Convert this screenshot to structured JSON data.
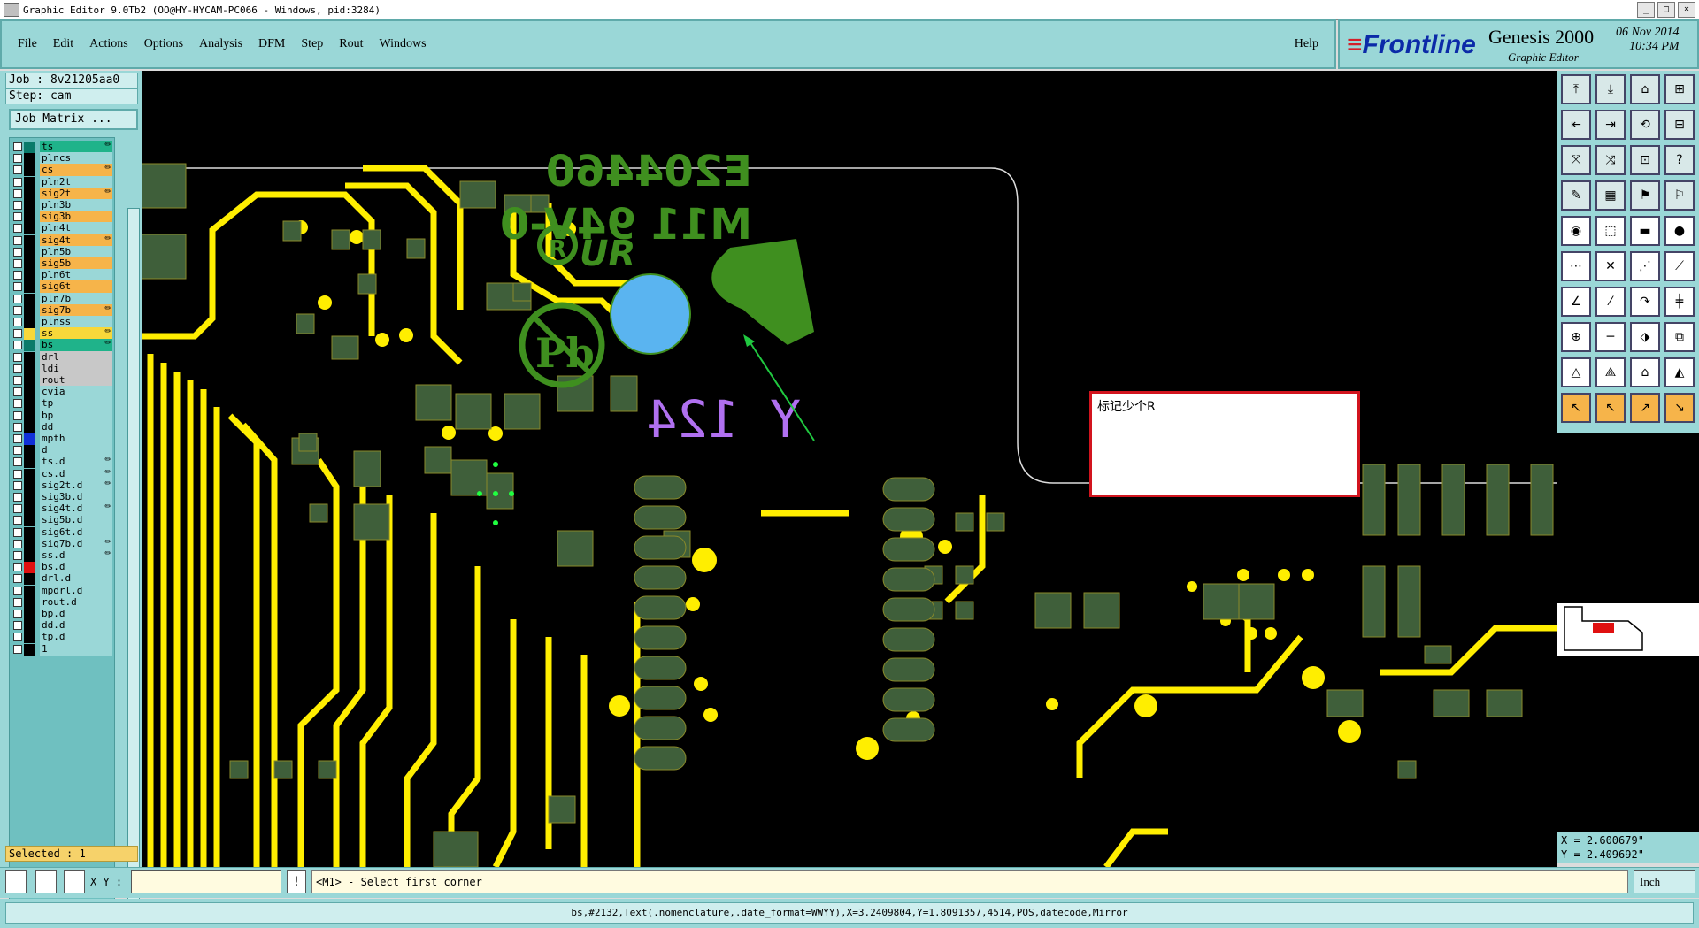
{
  "window": {
    "title": "Graphic Editor 9.0Tb2 (OO@HY-HYCAM-PC066 - Windows, pid:3284)"
  },
  "menu": {
    "items": [
      "File",
      "Edit",
      "Actions",
      "Options",
      "Analysis",
      "DFM",
      "Step",
      "Rout",
      "Windows"
    ],
    "help": "Help"
  },
  "brand": {
    "logo_main": "Frontline",
    "product": "Genesis 2000",
    "subtitle": "Graphic Editor",
    "date": "06 Nov 2014",
    "time": "10:34 PM"
  },
  "job": {
    "job_line": "Job : 8v21205aa0",
    "step_line": "Step: cam",
    "matrix_button": "Job Matrix ..."
  },
  "layers": [
    {
      "name": "ts",
      "color": "#1fb38a",
      "sw": "#0a7a6a",
      "mark": "✏"
    },
    {
      "name": "plncs",
      "color": "#9ad7d7",
      "sw": "#000000",
      "mark": ""
    },
    {
      "name": "cs",
      "color": "#f6b44a",
      "sw": "#000000",
      "mark": "✏"
    },
    {
      "name": "pln2t",
      "color": "#9ad7d7",
      "sw": "#000000",
      "mark": ""
    },
    {
      "name": "sig2t",
      "color": "#f6b44a",
      "sw": "#000000",
      "mark": "✏"
    },
    {
      "name": "pln3b",
      "color": "#9ad7d7",
      "sw": "#000000",
      "mark": ""
    },
    {
      "name": "sig3b",
      "color": "#f6b44a",
      "sw": "#000000",
      "mark": ""
    },
    {
      "name": "pln4t",
      "color": "#9ad7d7",
      "sw": "#000000",
      "mark": ""
    },
    {
      "name": "sig4t",
      "color": "#f6b44a",
      "sw": "#000000",
      "mark": "✏"
    },
    {
      "name": "pln5b",
      "color": "#9ad7d7",
      "sw": "#000000",
      "mark": ""
    },
    {
      "name": "sig5b",
      "color": "#f6b44a",
      "sw": "#000000",
      "mark": ""
    },
    {
      "name": "pln6t",
      "color": "#9ad7d7",
      "sw": "#000000",
      "mark": ""
    },
    {
      "name": "sig6t",
      "color": "#f6b44a",
      "sw": "#000000",
      "mark": ""
    },
    {
      "name": "pln7b",
      "color": "#9ad7d7",
      "sw": "#000000",
      "mark": ""
    },
    {
      "name": "sig7b",
      "color": "#f6b44a",
      "sw": "#000000",
      "mark": "✏"
    },
    {
      "name": "plnss",
      "color": "#9ad7d7",
      "sw": "#000000",
      "mark": ""
    },
    {
      "name": "ss",
      "color": "#f7d83a",
      "sw": "#f7d83a",
      "mark": "✏"
    },
    {
      "name": "bs",
      "color": "#1fb38a",
      "sw": "#0a7a6a",
      "mark": "✏"
    },
    {
      "name": "drl",
      "color": "#c8c8c8",
      "sw": "#000000",
      "mark": ""
    },
    {
      "name": "ldi",
      "color": "#c8c8c8",
      "sw": "#000000",
      "mark": ""
    },
    {
      "name": "rout",
      "color": "#c8c8c8",
      "sw": "#000000",
      "mark": ""
    },
    {
      "name": "cvia",
      "color": "#9ad7d7",
      "sw": "#000000",
      "mark": ""
    },
    {
      "name": "tp",
      "color": "#9ad7d7",
      "sw": "#000000",
      "mark": ""
    },
    {
      "name": "bp",
      "color": "#9ad7d7",
      "sw": "#000000",
      "mark": ""
    },
    {
      "name": "dd",
      "color": "#9ad7d7",
      "sw": "#000000",
      "mark": ""
    },
    {
      "name": "mpth",
      "color": "#9ad7d7",
      "sw": "#1030d8",
      "mark": ""
    },
    {
      "name": "d",
      "color": "#9ad7d7",
      "sw": "#000000",
      "mark": ""
    },
    {
      "name": "ts.d",
      "color": "#9ad7d7",
      "sw": "#000000",
      "mark": "✏"
    },
    {
      "name": "cs.d",
      "color": "#9ad7d7",
      "sw": "#000000",
      "mark": "✏"
    },
    {
      "name": "sig2t.d",
      "color": "#9ad7d7",
      "sw": "#000000",
      "mark": "✏"
    },
    {
      "name": "sig3b.d",
      "color": "#9ad7d7",
      "sw": "#000000",
      "mark": ""
    },
    {
      "name": "sig4t.d",
      "color": "#9ad7d7",
      "sw": "#000000",
      "mark": "✏"
    },
    {
      "name": "sig5b.d",
      "color": "#9ad7d7",
      "sw": "#000000",
      "mark": ""
    },
    {
      "name": "sig6t.d",
      "color": "#9ad7d7",
      "sw": "#000000",
      "mark": ""
    },
    {
      "name": "sig7b.d",
      "color": "#9ad7d7",
      "sw": "#000000",
      "mark": "✏"
    },
    {
      "name": "ss.d",
      "color": "#9ad7d7",
      "sw": "#000000",
      "mark": "✏"
    },
    {
      "name": "bs.d",
      "color": "#9ad7d7",
      "sw": "#e01010",
      "mark": ""
    },
    {
      "name": "drl.d",
      "color": "#9ad7d7",
      "sw": "#000000",
      "mark": ""
    },
    {
      "name": "mpdrl.d",
      "color": "#9ad7d7",
      "sw": "#000000",
      "mark": ""
    },
    {
      "name": "rout.d",
      "color": "#9ad7d7",
      "sw": "#000000",
      "mark": ""
    },
    {
      "name": "bp.d",
      "color": "#9ad7d7",
      "sw": "#000000",
      "mark": ""
    },
    {
      "name": "dd.d",
      "color": "#9ad7d7",
      "sw": "#000000",
      "mark": ""
    },
    {
      "name": "tp.d",
      "color": "#9ad7d7",
      "sw": "#000000",
      "mark": ""
    },
    {
      "name": "1",
      "color": "#9ad7d7",
      "sw": "#000000",
      "mark": ""
    }
  ],
  "selected": "Selected : 1",
  "canvas": {
    "silk_text_1": "E204460",
    "silk_text_2": "M11 94V-0",
    "silk_text_3": "Y 124",
    "note_text": "标记少个R"
  },
  "coords": {
    "x": "X = 2.600679\"",
    "y": "Y = 2.409692\""
  },
  "bottom": {
    "xy_label": "X Y :",
    "xy_value": "",
    "prompt": "<M1> - Select first corner",
    "unit": "Inch"
  },
  "status": "bs,#2132,Text(.nomenclature,.date_format=WWYY),X=3.2409804,Y=1.8091357,4514,POS,datecode,Mirror",
  "colors": {
    "panel": "#9ad7d7",
    "pad": "#3f5f3a",
    "trace": "#ffee00",
    "silk": "#3f8f1f",
    "highlight": "#5ab4f0",
    "selection": "#b070f0"
  }
}
